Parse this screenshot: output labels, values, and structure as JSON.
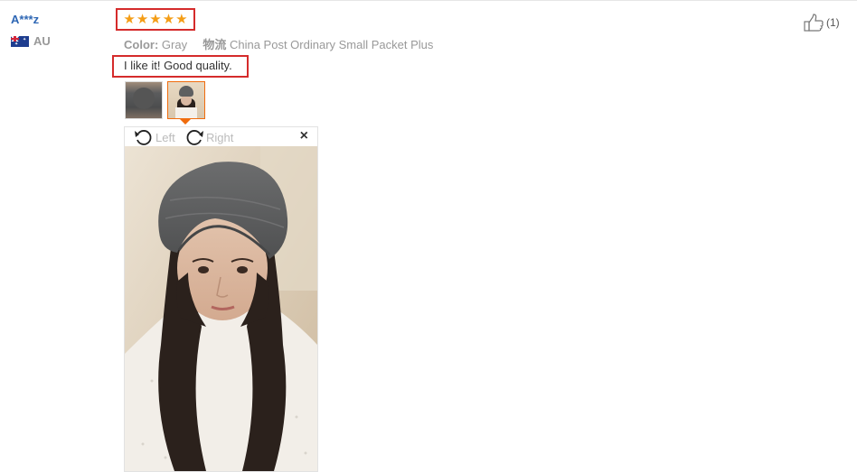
{
  "user": {
    "name": "A***z",
    "country": "AU"
  },
  "rating": {
    "stars": 5,
    "max": 5,
    "star_glyph": "★",
    "star_color": "#f49d15"
  },
  "meta": {
    "color_label": "Color:",
    "color_value": "Gray",
    "shipping_label": "物流",
    "shipping_value": "China Post Ordinary Small Packet Plus"
  },
  "review": {
    "text": "I like it! Good quality."
  },
  "helpful": {
    "count_text": "(1)"
  },
  "viewer": {
    "rotate_left_label": "Left",
    "rotate_right_label": "Right",
    "close_glyph": "×"
  },
  "colors": {
    "highlight_border": "#d52b2b",
    "selected_thumb": "#f06c0d",
    "username": "#2d66b4"
  }
}
